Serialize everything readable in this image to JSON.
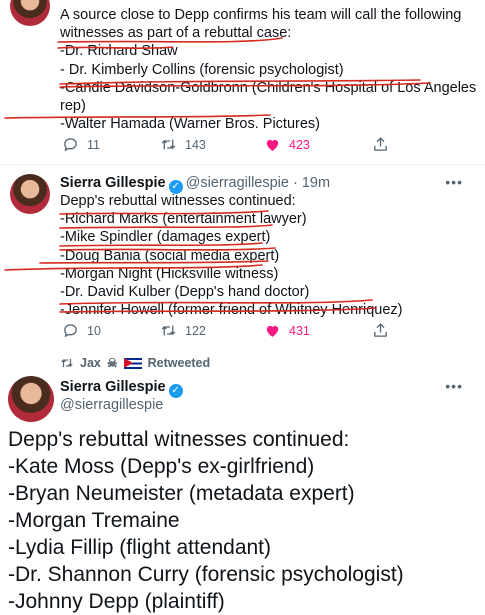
{
  "tweet1": {
    "text": "A source close to Depp confirms his team will call the following\nwitnesses as part of a rebuttal case:\n-Dr. Richard Shaw\n- Dr. Kimberly Collins (forensic psychologist)\n-Candie Davidson-Goldbronn (Children's Hospital of Los Angeles\nrep)\n-Walter Hamada (Warner Bros. Pictures)",
    "replies": "11",
    "retweets": "143",
    "likes": "423"
  },
  "tweet2": {
    "name": "Sierra Gillespie",
    "handle": "@sierragillespie",
    "time": "· 19m",
    "text": "Depp's rebuttal witnesses continued:\n-Richard Marks (entertainment lawyer)\n-Mike Spindler (damages expert)\n-Doug Bania (social media expert)\n-Morgan Night (Hicksville witness)\n-Dr. David Kulber (Depp's hand doctor)\n-Jennifer Howell (former friend of Whitney Henriquez)",
    "replies": "10",
    "retweets": "122",
    "likes": "431"
  },
  "retweet_banner": {
    "user": "Jax",
    "label": "Retweeted"
  },
  "tweet3": {
    "name": "Sierra Gillespie",
    "handle": "@sierragillespie",
    "text": "Depp's rebuttal witnesses continued:\n-Kate Moss (Depp's ex-girlfriend)\n-Bryan Neumeister (metadata expert)\n-Morgan Tremaine\n-Lydia Fillip (flight attendant)\n-Dr. Shannon Curry (forensic psychologist)\n-Johnny Depp (plaintiff)"
  },
  "icons": {
    "more": "more-icon",
    "reply": "reply-icon",
    "retweet": "retweet-icon",
    "like": "heart-icon",
    "share": "share-icon"
  },
  "colors": {
    "like": "#f91880",
    "verified": "#1d9bf0",
    "annotation": "#d42a1f"
  }
}
